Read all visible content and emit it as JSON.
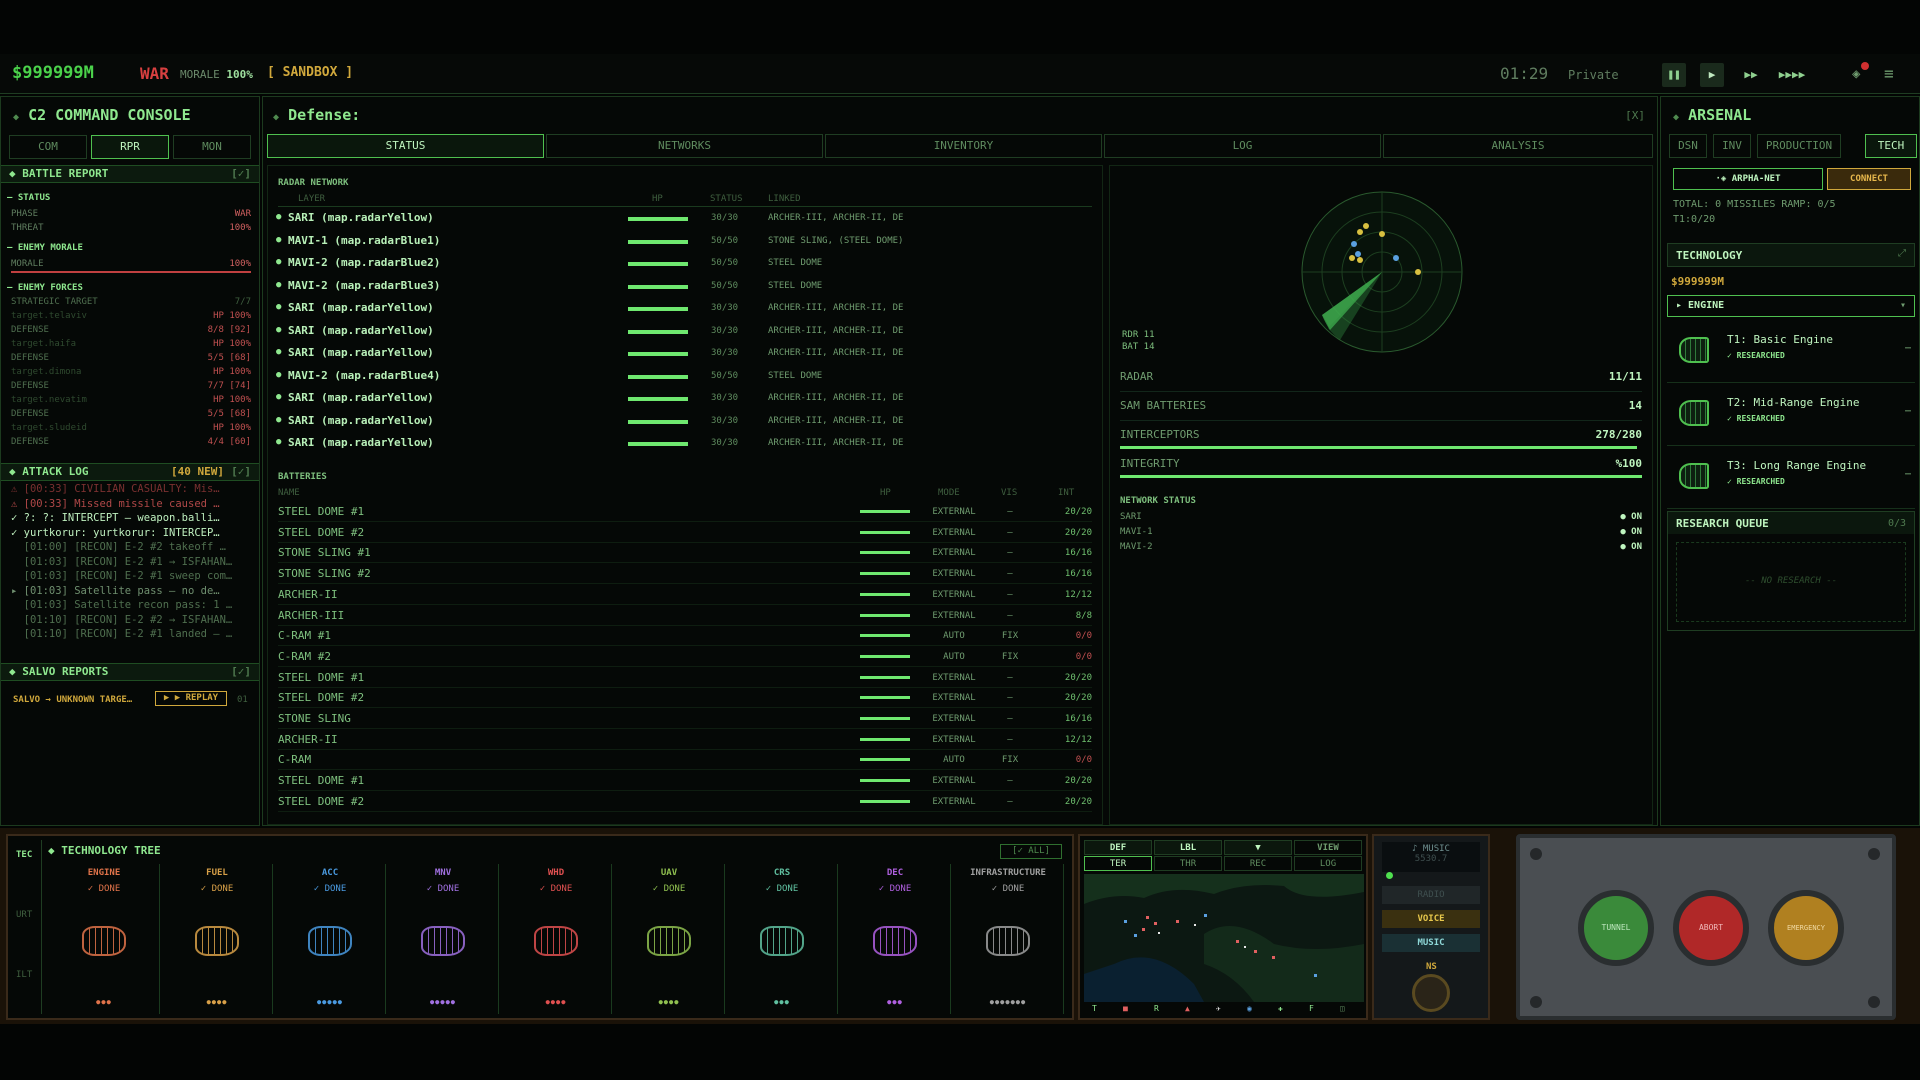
{
  "topbar": {
    "cash": "$999999M",
    "war": "WAR",
    "morale_label": "MORALE",
    "morale_value": "100%",
    "mode": "[ SANDBOX ]",
    "clock": "01:29",
    "rank": "Private",
    "controls": [
      "❚❚",
      "▶",
      "▶▶",
      "▶▶▶▶"
    ]
  },
  "left": {
    "title": "C2 COMMAND CONSOLE",
    "tabs": [
      "COM",
      "RPR",
      "MON"
    ],
    "battle_report": "BATTLE REPORT",
    "battle_report_flag": "[✓]",
    "status_head": "STATUS",
    "phase_label": "PHASE",
    "phase_value": "WAR",
    "threat_label": "THREAT",
    "threat_value": "100%",
    "enemy_morale_head": "ENEMY MORALE",
    "morale_label": "MORALE",
    "morale_value": "100%",
    "enemy_forces_head": "ENEMY FORCES",
    "forces": [
      {
        "k": "STRATEGIC TARGET",
        "v": "7/7"
      },
      {
        "k": "target.telaviv",
        "v": "HP 100%"
      },
      {
        "k": "DEFENSE",
        "v": "8/8 [92]"
      },
      {
        "k": "target.haifa",
        "v": "HP 100%"
      },
      {
        "k": "DEFENSE",
        "v": "5/5 [68]"
      },
      {
        "k": "target.dimona",
        "v": "HP 100%"
      },
      {
        "k": "DEFENSE",
        "v": "7/7 [74]"
      },
      {
        "k": "target.nevatim",
        "v": "HP 100%"
      },
      {
        "k": "DEFENSE",
        "v": "5/5 [68]"
      },
      {
        "k": "target.sludeid",
        "v": "HP 100%"
      },
      {
        "k": "DEFENSE",
        "v": "4/4 [60]"
      }
    ],
    "attack_log": "ATTACK LOG",
    "attack_log_new": "[40 NEW]",
    "attack_log_flag": "[✓]",
    "log": [
      {
        "t": "⚠ [00:33] CIVILIAN CASUALTY: Mis…",
        "c": "#7a3030"
      },
      {
        "t": "⚠ [00:33] Missed missile caused …",
        "c": "#b04848"
      },
      {
        "t": "✓ ?: ?: INTERCEPT — weapon.balli…",
        "c": "#bff0bf"
      },
      {
        "t": "✓ yurtkorur: yurtkorur: INTERCEP…",
        "c": "#bff0bf"
      },
      {
        "t": "  [01:00] [RECON] E-2 #2 takeoff …",
        "c": "#4f6f4f"
      },
      {
        "t": "  [01:03] [RECON] E-2 #1 → ISFAHAN…",
        "c": "#4f6f4f"
      },
      {
        "t": "  [01:03] [RECON] E-2 #1 sweep com…",
        "c": "#4f6f4f"
      },
      {
        "t": "▸ [01:03] Satellite pass — no de…",
        "c": "#6f8f6f"
      },
      {
        "t": "  [01:03] Satellite recon pass: 1 …",
        "c": "#4f6f4f"
      },
      {
        "t": "  [01:10] [RECON] E-2 #2 → ISFAHAN…",
        "c": "#4f6f4f"
      },
      {
        "t": "  [01:10] [RECON] E-2 #1 landed — …",
        "c": "#4f6f4f"
      }
    ],
    "salvo_head": "SALVO REPORTS",
    "salvo_flag": "[✓]",
    "salvo_item": "SALVO → UNKNOWN TARGE…",
    "replay": "▶ ▶ REPLAY",
    "salvo_time": "01"
  },
  "center": {
    "title": "Defense:",
    "close": "[X]",
    "tabs": [
      "STATUS",
      "NETWORKS",
      "INVENTORY",
      "LOG",
      "ANALYSIS"
    ],
    "radar_head": "RADAR NETWORK",
    "cols": {
      "layer": "LAYER",
      "hp": "HP",
      "status": "STATUS",
      "linked": "LINKED"
    },
    "radars": [
      {
        "n": "SARI (map.radarYellow)",
        "s": "30/30",
        "l": "ARCHER-III, ARCHER-II, DE"
      },
      {
        "n": "MAVI-1 (map.radarBlue1)",
        "s": "50/50",
        "l": "STONE SLING, (STEEL DOME)"
      },
      {
        "n": "MAVI-2 (map.radarBlue2)",
        "s": "50/50",
        "l": "STEEL DOME"
      },
      {
        "n": "MAVI-2 (map.radarBlue3)",
        "s": "50/50",
        "l": "STEEL DOME"
      },
      {
        "n": "SARI (map.radarYellow)",
        "s": "30/30",
        "l": "ARCHER-III, ARCHER-II, DE"
      },
      {
        "n": "SARI (map.radarYellow)",
        "s": "30/30",
        "l": "ARCHER-III, ARCHER-II, DE"
      },
      {
        "n": "SARI (map.radarYellow)",
        "s": "30/30",
        "l": "ARCHER-III, ARCHER-II, DE"
      },
      {
        "n": "MAVI-2 (map.radarBlue4)",
        "s": "50/50",
        "l": "STEEL DOME"
      },
      {
        "n": "SARI (map.radarYellow)",
        "s": "30/30",
        "l": "ARCHER-III, ARCHER-II, DE"
      },
      {
        "n": "SARI (map.radarYellow)",
        "s": "30/30",
        "l": "ARCHER-III, ARCHER-II, DE"
      },
      {
        "n": "SARI (map.radarYellow)",
        "s": "30/30",
        "l": "ARCHER-III, ARCHER-II, DE"
      }
    ],
    "batt_head": "BATTERIES",
    "bcols": {
      "name": "NAME",
      "hp": "HP",
      "mode": "MODE",
      "vis": "VIS",
      "int": "INT"
    },
    "batteries": [
      {
        "n": "STEEL DOME #1",
        "m": "EXTERNAL",
        "v": "—",
        "i": "20/20"
      },
      {
        "n": "STEEL DOME #2",
        "m": "EXTERNAL",
        "v": "—",
        "i": "20/20"
      },
      {
        "n": "STONE SLING #1",
        "m": "EXTERNAL",
        "v": "—",
        "i": "16/16"
      },
      {
        "n": "STONE SLING #2",
        "m": "EXTERNAL",
        "v": "—",
        "i": "16/16"
      },
      {
        "n": "ARCHER-II",
        "m": "EXTERNAL",
        "v": "—",
        "i": "12/12"
      },
      {
        "n": "ARCHER-III",
        "m": "EXTERNAL",
        "v": "—",
        "i": "8/8"
      },
      {
        "n": "C-RAM #1",
        "m": "AUTO",
        "v": "FIX",
        "i": "0/0"
      },
      {
        "n": "C-RAM #2",
        "m": "AUTO",
        "v": "FIX",
        "i": "0/0"
      },
      {
        "n": "STEEL DOME #1",
        "m": "EXTERNAL",
        "v": "—",
        "i": "20/20"
      },
      {
        "n": "STEEL DOME #2",
        "m": "EXTERNAL",
        "v": "—",
        "i": "20/20"
      },
      {
        "n": "STONE SLING",
        "m": "EXTERNAL",
        "v": "—",
        "i": "16/16"
      },
      {
        "n": "ARCHER-II",
        "m": "EXTERNAL",
        "v": "—",
        "i": "12/12"
      },
      {
        "n": "C-RAM",
        "m": "AUTO",
        "v": "FIX",
        "i": "0/0"
      },
      {
        "n": "STEEL DOME #1",
        "m": "EXTERNAL",
        "v": "—",
        "i": "20/20"
      },
      {
        "n": "STEEL DOME #2",
        "m": "EXTERNAL",
        "v": "—",
        "i": "20/20"
      }
    ],
    "rdr": "RDR 11",
    "bat": "BAT 14",
    "stats": [
      {
        "k": "RADAR",
        "v": "11/11",
        "fill": 0
      },
      {
        "k": "SAM BATTERIES",
        "v": "14",
        "fill": 0
      },
      {
        "k": "INTERCEPTORS",
        "v": "278/280",
        "fill": 0.99
      },
      {
        "k": "INTEGRITY",
        "v": "%100",
        "fill": 1
      }
    ],
    "net_head": "NETWORK STATUS",
    "nets": [
      {
        "k": "SARI",
        "v": "● ON"
      },
      {
        "k": "MAVI-1",
        "v": "● ON"
      },
      {
        "k": "MAVI-2",
        "v": "● ON"
      }
    ]
  },
  "right": {
    "title": "ARSENAL",
    "tabs": [
      "DSN",
      "INV",
      "PRODUCTION",
      "TECH"
    ],
    "net": "·◈ ARPHA-NET",
    "connect": "CONNECT",
    "total": "TOTAL: 0 MISSILES RAMP: 0/5",
    "t1": "T1:0/20",
    "tech_head": "TECHNOLOGY",
    "cash": "$999999M",
    "engine": "▸ ENGINE",
    "caret": "▾",
    "techs": [
      {
        "n": "T1: Basic Engine",
        "s": "✓ RESEARCHED"
      },
      {
        "n": "T2: Mid-Range Engine",
        "s": "✓ RESEARCHED"
      },
      {
        "n": "T3: Long Range Engine",
        "s": "✓ RESEARCHED"
      }
    ],
    "queue_head": "RESEARCH QUEUE",
    "queue_count": "0/3",
    "queue_empty": "-- NO RESEARCH --"
  },
  "bottom": {
    "side_tabs": [
      "TEC",
      "URT",
      "ILT"
    ],
    "tree_head": "TECHNOLOGY TREE",
    "all": "[✓ ALL]",
    "cats": [
      {
        "n": "ENGINE",
        "d": "✓ DONE",
        "c": "#e0734a",
        "dots": "●●●"
      },
      {
        "n": "FUEL",
        "d": "✓ DONE",
        "c": "#d8a048",
        "dots": "●●●●"
      },
      {
        "n": "ACC",
        "d": "✓ DONE",
        "c": "#4a9ae0",
        "dots": "●●●●●"
      },
      {
        "n": "MNV",
        "d": "✓ DONE",
        "c": "#a070e0",
        "dots": "●●●●●"
      },
      {
        "n": "WHD",
        "d": "✓ DONE",
        "c": "#e05050",
        "dots": "●●●●"
      },
      {
        "n": "UAV",
        "d": "✓ DONE",
        "c": "#90c050",
        "dots": "●●●●"
      },
      {
        "n": "CRS",
        "d": "✓ DONE",
        "c": "#60c0a0",
        "dots": "●●●"
      },
      {
        "n": "DEC",
        "d": "✓ DONE",
        "c": "#b060e0",
        "dots": "●●●"
      },
      {
        "n": "INFRASTRUCTURE",
        "d": "✓ DONE",
        "c": "#a0a0a0",
        "dots": "●●●●●●●"
      }
    ],
    "map_tabs1": [
      "DEF",
      "LBL",
      "▼",
      "VIEW"
    ],
    "map_tabs2": [
      "TER",
      "THR",
      "REC",
      "LOG"
    ],
    "map_legend": [
      "T",
      "■",
      "R",
      "▲",
      "✈",
      "◉",
      "✚",
      "F",
      "◫"
    ],
    "audio": {
      "music_top": "♪ MUSIC",
      "freq": "5530.7",
      "radio": "RADIO",
      "voice": "VOICE",
      "music": "MUSIC",
      "ns": "NS"
    },
    "buttons": [
      "TUNNEL",
      "ABORT",
      "EMERGENCY"
    ]
  }
}
